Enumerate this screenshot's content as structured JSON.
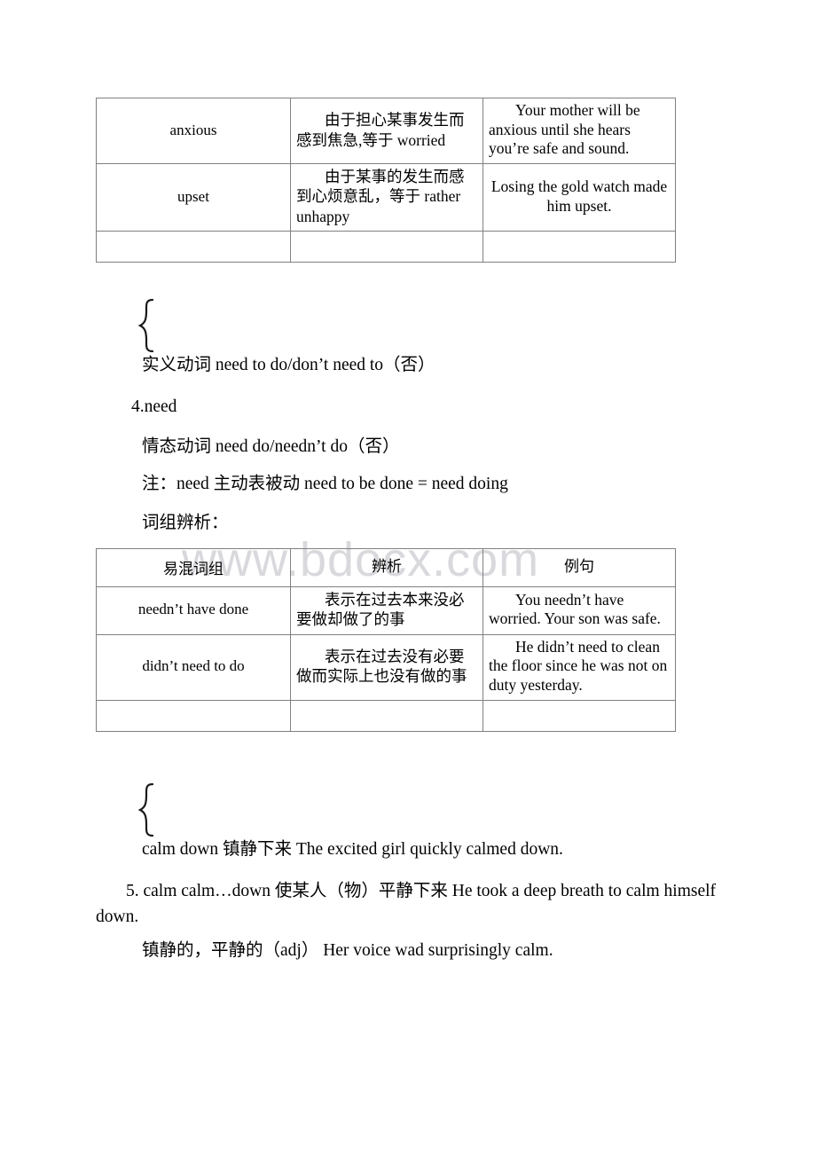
{
  "document": {
    "watermark": "www.bdocx.com",
    "tables": [
      {
        "name": "adjective-comparison",
        "has_header": false,
        "rows": [
          {
            "term": "anxious",
            "definition": "由于担心某事发生而感到焦急,等于 worried",
            "example": "Your mother will be anxious until she hears you’re safe and sound."
          },
          {
            "term": "upset",
            "definition": "由于某事的发生而感到心烦意乱，等于 rather unhappy",
            "example": "Losing the gold watch made him upset."
          }
        ],
        "trailing_empty_row": true
      },
      {
        "name": "phrase-comparison",
        "has_header": true,
        "headers": [
          "易混词组",
          "辨析",
          "例句"
        ],
        "rows": [
          {
            "term": "needn’t have done",
            "definition": "表示在过去本来没必要做却做了的事",
            "example": "You needn’t have worried. Your son was safe."
          },
          {
            "term": "didn’t need to do",
            "definition": "表示在过去没有必要做而实际上也没有做的事",
            "example": "He didn’t need to clean the floor since he was not on duty yesterday."
          }
        ],
        "trailing_empty_row": true
      }
    ],
    "notes": {
      "need_section": {
        "line_notional_verb": "实义动词 need to do/don’t need to（否）",
        "heading": "4.need",
        "line_modal_verb": "情态动词 need do/needn’t do（否）",
        "remark": "注：need 主动表被动 need to be done = need doing",
        "subheading": "词组辨析："
      },
      "calm_section": {
        "line_calm_down": "calm down 镇静下来 The excited girl quickly calmed down.",
        "entry": "5. calm  calm…down 使某人（物）平静下来 He took a deep breath to calm himself down.",
        "adjective_line": "镇静的，平静的（adj） Her voice wad surprisingly calm."
      }
    }
  }
}
